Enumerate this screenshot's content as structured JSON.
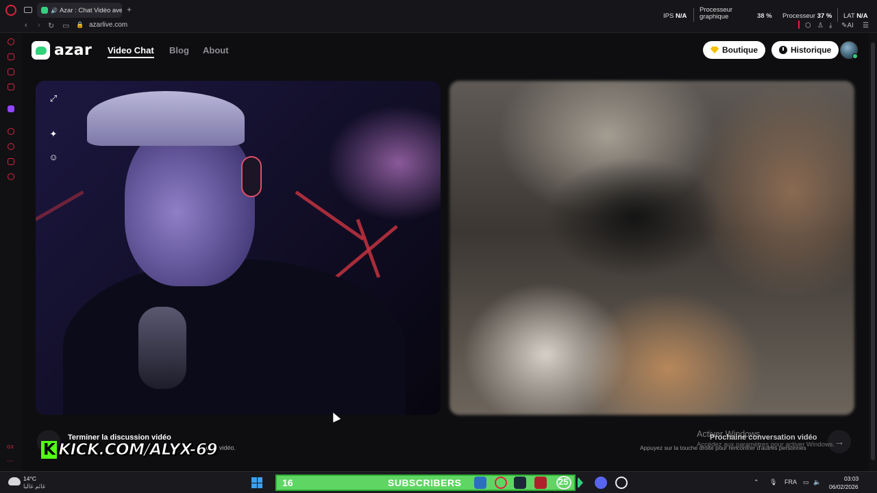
{
  "browser": {
    "tab_title": "Azar : Chat Vidéo avec",
    "new_tab_symbol": "+",
    "url": "azarlive.com",
    "stats": {
      "ips_label": "IPS",
      "ips_value": "N/A",
      "gpu_label_line1": "Processeur",
      "gpu_label_line2": "graphique",
      "gpu_value": "38 %",
      "cpu_label": "Processeur",
      "cpu_value": "37 %",
      "lat_label": "LAT",
      "lat_value": "N/A"
    },
    "ai_label": "AI"
  },
  "sidebar": {
    "bottom_label": "GX"
  },
  "site": {
    "logo_text": "azar",
    "nav": [
      {
        "label": "Video Chat",
        "active": true
      },
      {
        "label": "Blog",
        "active": false
      },
      {
        "label": "About",
        "active": false
      }
    ],
    "shop_label": "Boutique",
    "history_label": "Historique"
  },
  "chat": {
    "end_title": "Terminer la discussion vidéo",
    "end_sub": "chat vidéo.",
    "next_title": "Prochaine conversation vidéo",
    "next_sub": "Appuyez sur la touche droite pour rencontrer d'autres personnes"
  },
  "overlay": {
    "kick_letter": "K",
    "kick_url": "KICK.COM/ALYX-69",
    "subs_count": "16",
    "subs_label": "SUBSCRIBERS"
  },
  "windows": {
    "activate_title": "Activer Windows",
    "activate_sub": "Accédez aux paramètres pour activer Windows."
  },
  "taskbar": {
    "temp": "14°C",
    "weather_desc": "غائم غالبا",
    "badge_num": "25",
    "lang": "FRA",
    "time": "03:03",
    "date": "06/02/2026"
  },
  "colors": {
    "kick_green": "#53fc18",
    "azar_green": "#2fd27a",
    "subs_bar": "#5fd664",
    "opera_red": "#e0213c"
  }
}
